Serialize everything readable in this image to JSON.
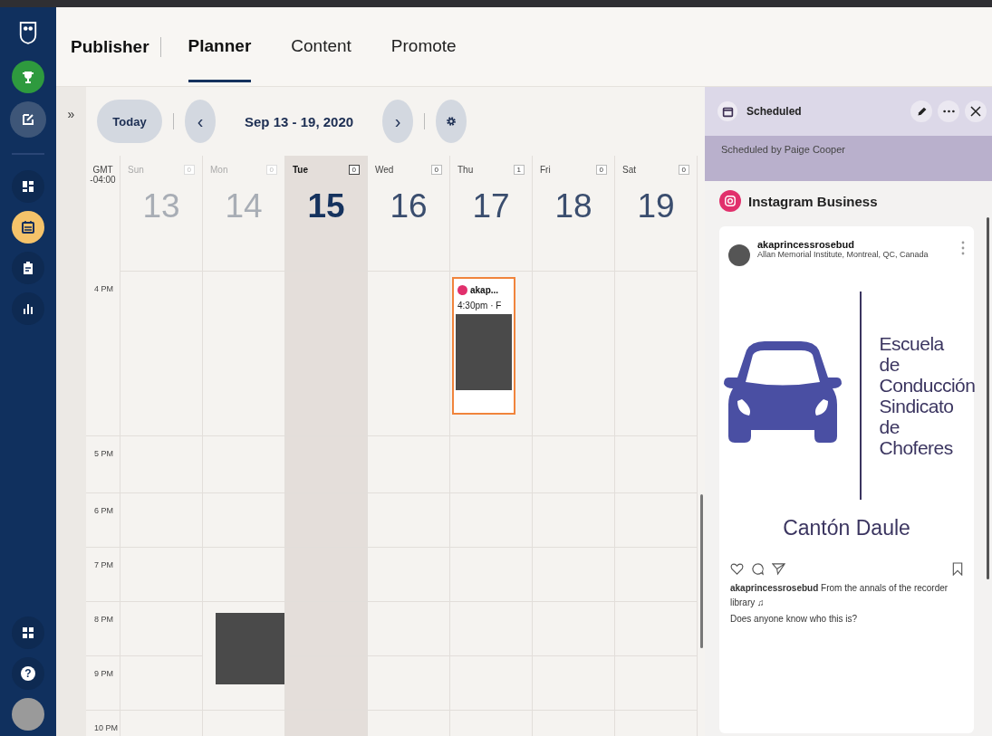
{
  "sidebar": {
    "items": [
      {
        "kind": "trophy",
        "selected": false
      },
      {
        "kind": "compose",
        "selected": false
      },
      {
        "kind": "dashboard",
        "selected": false
      },
      {
        "kind": "calendar",
        "selected": true
      },
      {
        "kind": "clipboard",
        "selected": false
      },
      {
        "kind": "analytics",
        "selected": false
      }
    ],
    "bottom_items": [
      {
        "kind": "apps"
      },
      {
        "kind": "help",
        "label": "?"
      },
      {
        "kind": "avatar"
      }
    ]
  },
  "header": {
    "app": "Publisher",
    "tabs": [
      {
        "label": "Planner",
        "selected": true
      },
      {
        "label": "Content",
        "selected": false
      },
      {
        "label": "Promote",
        "selected": false
      }
    ]
  },
  "collapse": {
    "label": "»"
  },
  "toolbar": {
    "today": "Today",
    "prev": "‹",
    "range": "Sep 13 - 19, 2020",
    "next": "›"
  },
  "timezone": [
    "GMT",
    "-04:00"
  ],
  "days": [
    {
      "name": "Sun",
      "date": "13",
      "count": "0",
      "past": true,
      "selected": false
    },
    {
      "name": "Mon",
      "date": "14",
      "count": "0",
      "past": true,
      "selected": false
    },
    {
      "name": "Tue",
      "date": "15",
      "count": "0",
      "past": false,
      "selected": true
    },
    {
      "name": "Wed",
      "date": "16",
      "count": "0",
      "past": false,
      "selected": false
    },
    {
      "name": "Thu",
      "date": "17",
      "count": "1",
      "past": false,
      "selected": false
    },
    {
      "name": "Fri",
      "date": "18",
      "count": "0",
      "past": false,
      "selected": false
    },
    {
      "name": "Sat",
      "date": "19",
      "count": "0",
      "past": false,
      "selected": false
    }
  ],
  "hours": [
    {
      "label": "4 PM",
      "cells": [
        {},
        {},
        {},
        {},
        {
          "event": {
            "kind": "post",
            "account": "akap...",
            "time": "4:30pm · F",
            "selected": true
          }
        },
        {},
        {}
      ]
    },
    {
      "label": "5 PM",
      "cells": [
        {},
        {},
        {},
        {},
        {},
        {},
        {}
      ]
    },
    {
      "label": "6 PM",
      "cells": [
        {},
        {},
        {},
        {},
        {},
        {},
        {}
      ]
    },
    {
      "label": "7 PM",
      "cells": [
        {},
        {},
        {},
        {},
        {},
        {},
        {}
      ]
    },
    {
      "label": "8 PM",
      "cells": [
        {},
        {
          "spans_two_hours": true,
          "event": {
            "kind": "thumbnail",
            "selected": false
          }
        },
        {},
        {},
        {},
        {},
        {}
      ]
    },
    {
      "label": "9 PM",
      "cells": [
        {},
        {},
        {},
        {},
        {},
        {},
        {}
      ]
    },
    {
      "label": "10 PM",
      "cells": [
        {},
        {},
        {},
        {},
        {},
        {},
        {}
      ]
    }
  ],
  "panel": {
    "title": "Scheduled",
    "subtitle": "Scheduled by Paige Cooper",
    "network": "Instagram Business",
    "post": {
      "username": "akaprincessrosebud",
      "location": "Allan Memorial Institute, Montreal, QC, Canada",
      "image_lines": [
        "Escuela",
        "de",
        "Conducción",
        "Sindicato",
        "de",
        "Choferes"
      ],
      "image_footer": "Cantón Daule",
      "caption": "**akaprincessrosebud** From the annals of the recorder library ♫",
      "caption_2": "Does anyone know who this is?"
    }
  }
}
